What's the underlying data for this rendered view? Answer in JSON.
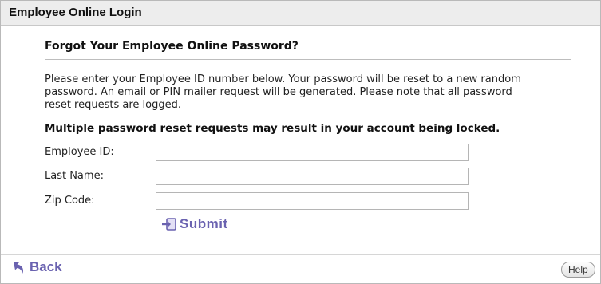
{
  "header": {
    "title": "Employee Online Login"
  },
  "main": {
    "section_title": "Forgot Your Employee Online Password?",
    "intro_lines": [
      "Please enter your Employee ID number below. Your password will be reset to a new random",
      "password. An email or PIN mailer request will be generated. Please note that all password",
      "reset requests are logged."
    ],
    "warning": "Multiple password reset requests may result in your account being locked."
  },
  "form": {
    "employee_id_label": "Employee ID:",
    "employee_id_value": "",
    "last_name_label": "Last Name:",
    "last_name_value": "",
    "zip_code_label": "Zip Code:",
    "zip_code_value": "",
    "submit_label": "Submit"
  },
  "footer": {
    "back_label": "Back",
    "help_label": "Help"
  },
  "icons": {
    "submit": "arrow-into-box-icon",
    "back": "back-arrow-icon"
  },
  "colors": {
    "link": "#6a62b0",
    "header_bg": "#ededed"
  }
}
